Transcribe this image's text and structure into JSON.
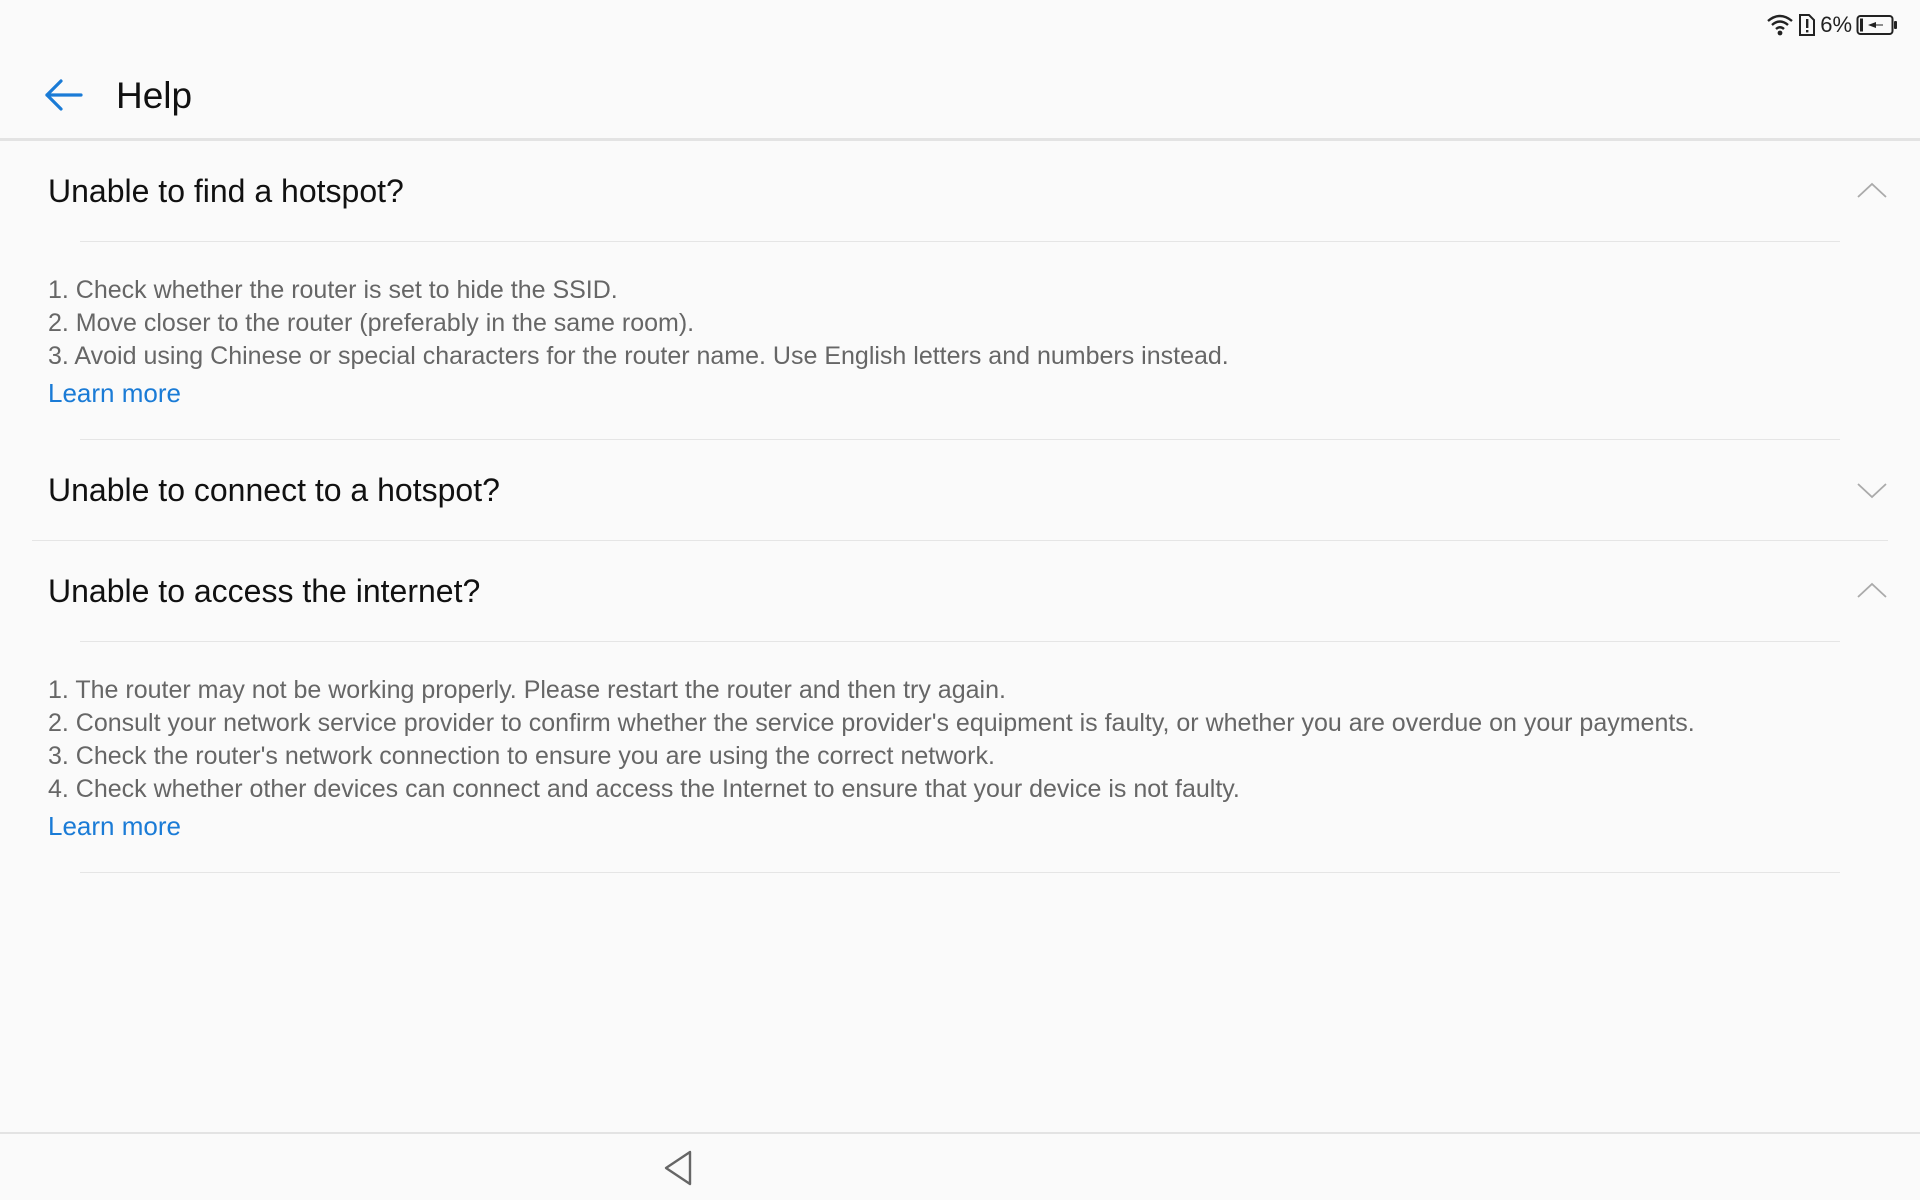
{
  "status_bar": {
    "battery_percent": "6%",
    "icons": [
      "wifi-icon",
      "sim-alert-icon",
      "battery-charging-icon"
    ]
  },
  "header": {
    "title": "Help",
    "back_icon": "arrow-left-icon"
  },
  "colors": {
    "accent": "#1a7bd6",
    "background": "#fafafa",
    "body_text": "#666666",
    "divider": "#e5e5e5"
  },
  "sections": [
    {
      "title": "Unable to find a hotspot?",
      "expanded": true,
      "chevron": "chevron-up-icon",
      "lines": [
        "1. Check whether the router is set to hide the SSID.",
        "2. Move closer to the router (preferably in the same room).",
        "3. Avoid using Chinese or special characters for the router name. Use English letters and numbers instead."
      ],
      "link": "Learn more"
    },
    {
      "title": "Unable to connect to a hotspot?",
      "expanded": false,
      "chevron": "chevron-down-icon"
    },
    {
      "title": "Unable to access the internet?",
      "expanded": true,
      "chevron": "chevron-up-icon",
      "lines": [
        "1. The router may not be working properly. Please restart the router and then try again.",
        "2. Consult your network service provider to confirm whether the service provider's equipment is faulty, or whether you are overdue on your payments.",
        "3. Check the router's network connection to ensure you are using the correct network.",
        "4. Check whether other devices can connect and access the Internet to ensure that your device is not faulty."
      ],
      "link": "Learn more"
    }
  ],
  "nav_bar": {
    "back_icon": "nav-back-triangle-icon"
  }
}
